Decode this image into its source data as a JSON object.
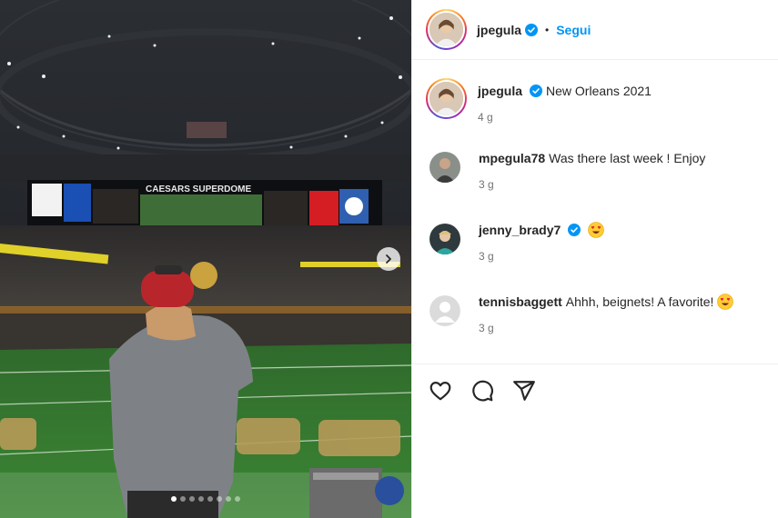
{
  "post": {
    "photo_alt_text": "",
    "carousel": {
      "total": 8,
      "active": 0
    }
  },
  "header": {
    "username": "jpegula",
    "separator": "•",
    "follow_label": "Segui"
  },
  "caption": {
    "username": "jpegula",
    "text": "New Orleans 2021",
    "time": "4 g"
  },
  "comments": [
    {
      "username": "mpegula78",
      "text": "Was there last week ! Enjoy",
      "time": "3 g",
      "verified": false
    },
    {
      "username": "jenny_brady7",
      "text": "",
      "time": "3 g",
      "verified": true,
      "emoji": "heart-eyes"
    },
    {
      "username": "tennisbaggett",
      "text": "Ahhh, beignets! A favorite!",
      "time": "3 g",
      "verified": false,
      "emoji": "heart-eyes"
    }
  ],
  "actions": [
    "like-icon",
    "comment-icon",
    "share-icon"
  ],
  "colors": {
    "accent": "#0095f6",
    "verified": "#0095f6",
    "text": "#262626",
    "muted": "#737373"
  }
}
